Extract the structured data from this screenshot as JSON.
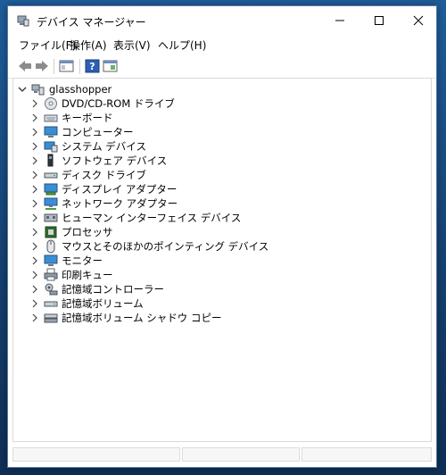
{
  "window": {
    "title": "デバイス マネージャー"
  },
  "menu": [
    "ファイル(F)",
    "操作(A)",
    "表示(V)",
    "ヘルプ(H)"
  ],
  "tree": {
    "root": "glasshopper",
    "items": [
      {
        "label": "DVD/CD-ROM ドライブ",
        "icon": "dvd-drive-icon"
      },
      {
        "label": "キーボード",
        "icon": "keyboard-icon"
      },
      {
        "label": "コンピューター",
        "icon": "computer-icon"
      },
      {
        "label": "システム デバイス",
        "icon": "system-device-icon"
      },
      {
        "label": "ソフトウェア デバイス",
        "icon": "software-device-icon"
      },
      {
        "label": "ディスク ドライブ",
        "icon": "disk-drive-icon"
      },
      {
        "label": "ディスプレイ アダプター",
        "icon": "display-adapter-icon"
      },
      {
        "label": "ネットワーク アダプター",
        "icon": "network-adapter-icon"
      },
      {
        "label": "ヒューマン インターフェイス デバイス",
        "icon": "hid-icon"
      },
      {
        "label": "プロセッサ",
        "icon": "processor-icon"
      },
      {
        "label": "マウスとそのほかのポインティング デバイス",
        "icon": "mouse-icon"
      },
      {
        "label": "モニター",
        "icon": "monitor-icon"
      },
      {
        "label": "印刷キュー",
        "icon": "printer-icon"
      },
      {
        "label": "記憶域コントローラー",
        "icon": "storage-controller-icon"
      },
      {
        "label": "記憶域ボリューム",
        "icon": "storage-volume-icon"
      },
      {
        "label": "記憶域ボリューム シャドウ コピー",
        "icon": "shadow-copy-icon"
      }
    ]
  }
}
